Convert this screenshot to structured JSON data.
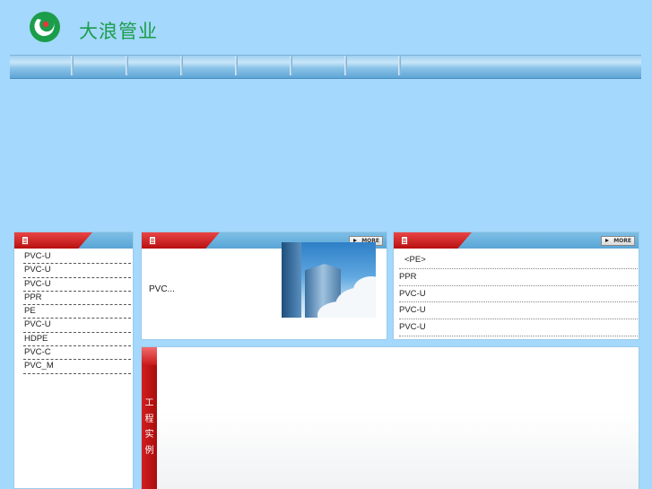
{
  "header": {
    "brand_name": "大浪管业",
    "logo": "dalang-logo"
  },
  "nav": {
    "separators": 7
  },
  "product_panel": {
    "items": [
      "PVC-U",
      "PVC-U",
      "PVC-U",
      "PPR",
      "PE",
      "PVC-U",
      "HDPE",
      "PVC-C",
      "PVC_M"
    ]
  },
  "news_panel": {
    "more_label": "MORE",
    "text": "PVC...",
    "image": "building-photo"
  },
  "right_panel": {
    "more_label": "MORE",
    "items": [
      "<PE>",
      "PPR",
      "PVC-U",
      "PVC-U",
      "PVC-U"
    ]
  },
  "projects_panel": {
    "title": "工\n程\n实\n例"
  },
  "colors": {
    "background": "#a4d8fc",
    "brand_green": "#1b9d4a",
    "tab_red": "#c91a1a",
    "panel_blue": "#5aa5d6"
  }
}
